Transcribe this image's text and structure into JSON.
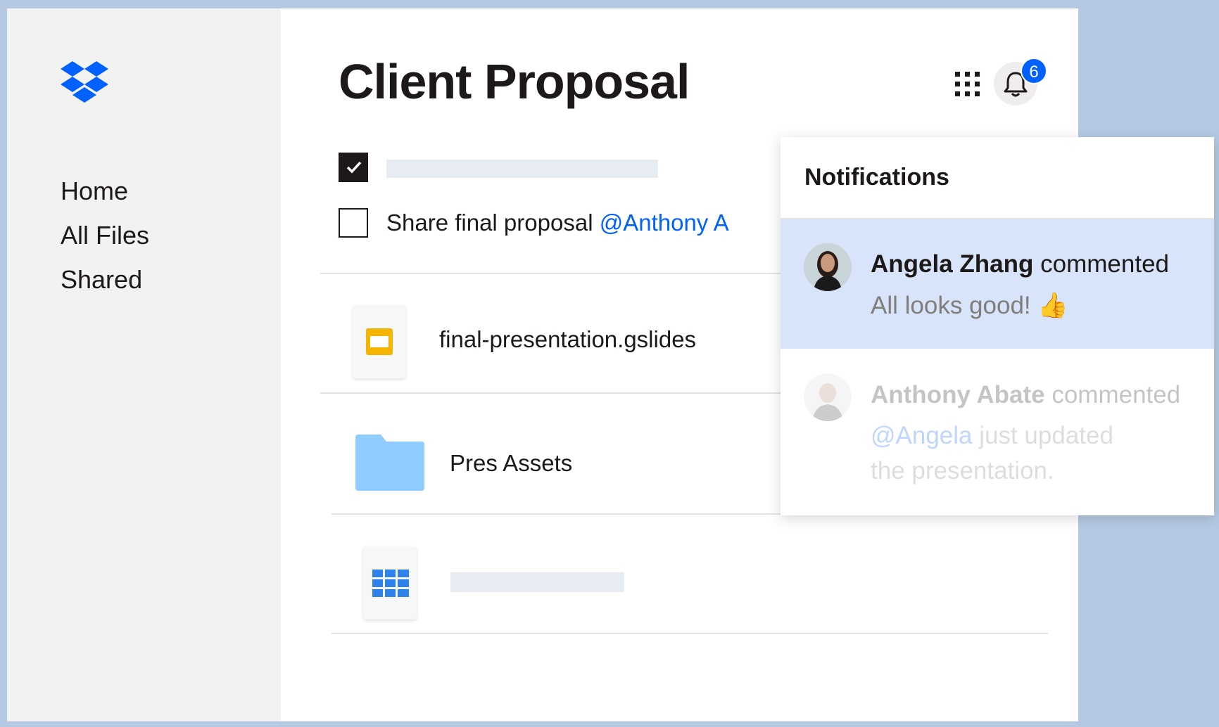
{
  "brand": {
    "accent": "#0061fe",
    "logo_icon": "dropbox-logo-icon"
  },
  "sidebar": {
    "items": [
      {
        "label": "Home"
      },
      {
        "label": "All Files"
      },
      {
        "label": "Shared"
      }
    ]
  },
  "header": {
    "title": "Client Proposal",
    "apps_icon": "apps-grid-icon",
    "bell_icon": "bell-icon",
    "notification_count": "6"
  },
  "tasks": [
    {
      "checked": true,
      "text": ""
    },
    {
      "checked": false,
      "text": "Share final proposal",
      "mention": "@Anthony A"
    }
  ],
  "files": [
    {
      "name": "final-presentation.gslides",
      "icon": "slides-icon"
    },
    {
      "name": "Pres Assets",
      "icon": "folder-icon"
    },
    {
      "name": "",
      "icon": "spreadsheet-icon"
    }
  ],
  "notifications": {
    "title": "Notifications",
    "items": [
      {
        "author": "Angela Zhang",
        "action": "commented",
        "message": "All looks good! 👍",
        "active": true
      },
      {
        "author": "Anthony Abate",
        "action": "commented",
        "mention": "@Angela",
        "message_rest": " just updated",
        "message_line2": "the presentation.",
        "active": false
      }
    ]
  }
}
